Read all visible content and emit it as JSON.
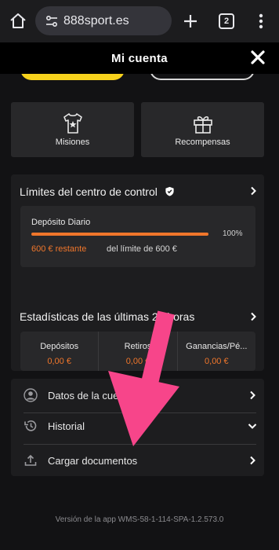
{
  "browser": {
    "url": "888sport.es",
    "tab_count": "2"
  },
  "header": {
    "title": "Mi cuenta"
  },
  "tiles": [
    {
      "label": "Misiones",
      "icon": "shirt-star-icon"
    },
    {
      "label": "Recompensas",
      "icon": "gift-icon"
    }
  ],
  "limits": {
    "title": "Límites del centro de control",
    "deposit_label": "Depósito Diario",
    "progress_percent": 100,
    "progress_text": "100%",
    "remaining_amount": "600 € restante",
    "remaining_rest": "del límite de 600 €"
  },
  "stats": {
    "title": "Estadísticas de las últimas 24 horas",
    "items": [
      {
        "label": "Depósitos",
        "value": "0,00 €"
      },
      {
        "label": "Retiros",
        "value": "0,00 €"
      },
      {
        "label": "Ganancias/Pé...",
        "value": "0,00 €"
      }
    ]
  },
  "menu": {
    "items": [
      {
        "label": "Datos de la cuenta",
        "icon": "user-circle-icon"
      },
      {
        "label": "Historial",
        "icon": "history-icon"
      },
      {
        "label": "Cargar documentos",
        "icon": "upload-icon"
      }
    ]
  },
  "version": "Versión de la app WMS-58-1-114-SPA-1.2.573.0",
  "colors": {
    "accent_orange": "#f0762b",
    "yellow": "#f7d21c",
    "annotation_arrow": "#f7458a"
  }
}
